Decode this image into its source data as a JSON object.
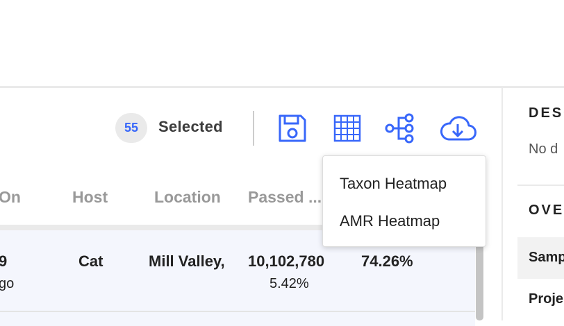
{
  "toolbar": {
    "selected_count": "55",
    "selected_label": "Selected",
    "icons": [
      "save-icon",
      "grid-icon",
      "tree-icon",
      "cloud-download-icon"
    ],
    "accent_color": "#3867fa"
  },
  "table": {
    "columns": [
      "On",
      "Host",
      "Location",
      "Passed ...",
      ""
    ],
    "rows": [
      {
        "date_fragment": "9",
        "date_sub_fragment": "go",
        "host": "Cat",
        "location": "Mill Valley,",
        "reads": "10,102,780",
        "reads_sub": "5.42%",
        "passed": "74.26%"
      }
    ]
  },
  "dropdown": {
    "items": [
      "Taxon Heatmap",
      "AMR Heatmap"
    ]
  },
  "right_panel": {
    "description_heading": "DESC",
    "description_text": "No d",
    "overview_heading": "OVE",
    "rows": [
      "Samp",
      "Proje"
    ]
  }
}
